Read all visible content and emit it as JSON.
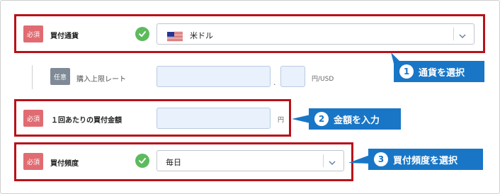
{
  "currency_row": {
    "badge": "必須",
    "label": "買付通貨",
    "selected": "米ドル",
    "icons": {
      "check": "check-icon",
      "flag": "us-flag-icon",
      "chevron": "chevron-down-icon"
    }
  },
  "rate_row": {
    "badge": "任意",
    "label": "購入上限レート",
    "integer_value": "",
    "decimal_value": "",
    "separator": ".",
    "unit": "円/USD"
  },
  "amount_row": {
    "badge": "必須",
    "label": "１回あたりの買付金額",
    "amount_value": "",
    "unit": "円"
  },
  "frequency_row": {
    "badge": "必須",
    "label": "買付頻度",
    "selected": "毎日",
    "icons": {
      "check": "check-icon",
      "chevron": "chevron-down-icon"
    }
  },
  "callouts": [
    {
      "num": "1",
      "text": "通貨を選択"
    },
    {
      "num": "2",
      "text": "金額を入力"
    },
    {
      "num": "3",
      "text": "買付頻度を選択"
    }
  ],
  "colors": {
    "highlight": "#b8121a",
    "callout": "#1976c6",
    "required_badge": "#e06c72",
    "optional_badge": "#7f8a97",
    "check": "#5dba5d",
    "input_fill": "#e9f1fc"
  }
}
